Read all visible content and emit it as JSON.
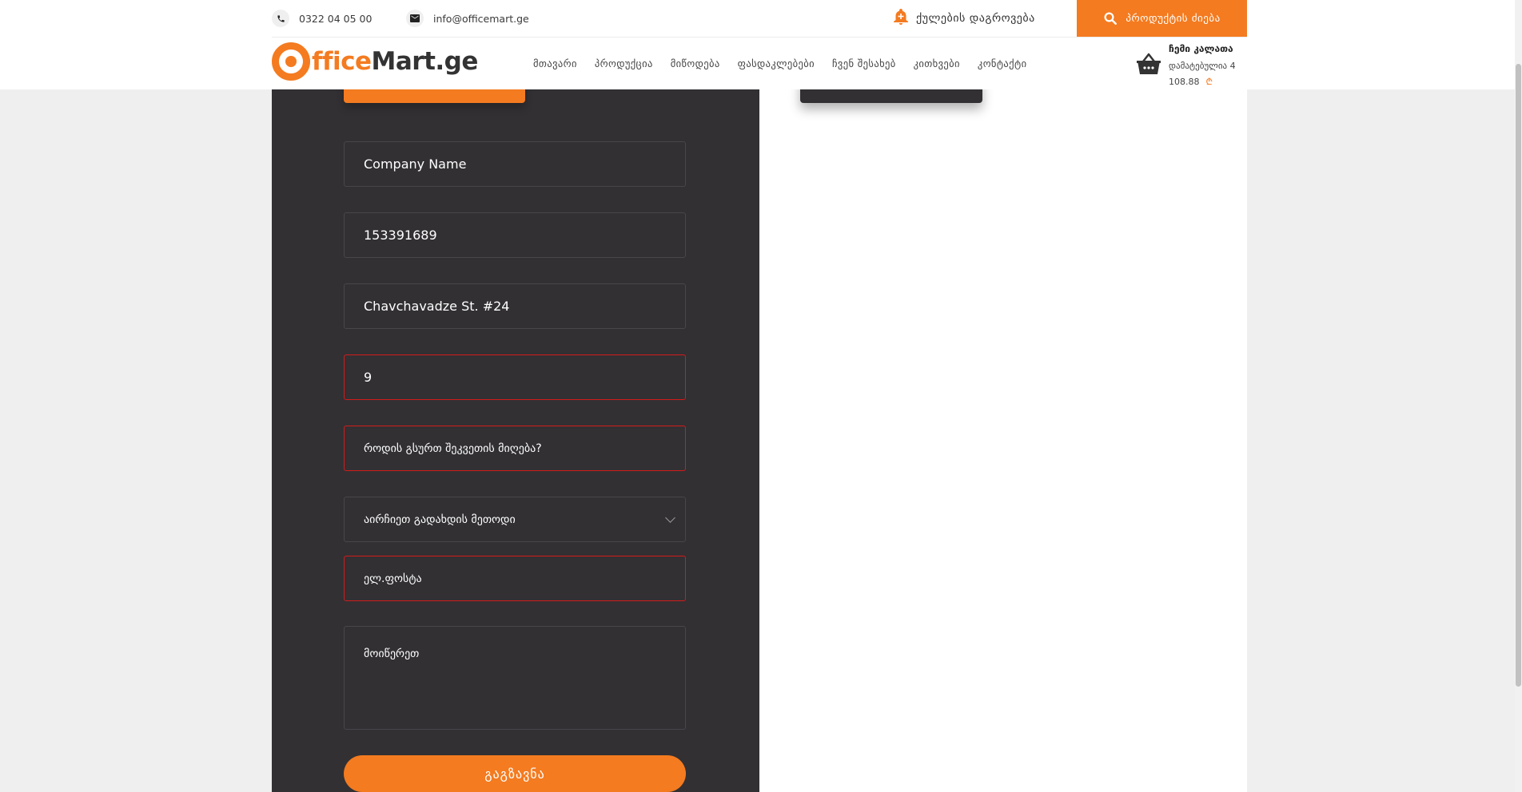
{
  "header": {
    "phone": "0322 04 05 00",
    "email": "info@officemart.ge",
    "order_tracking": "ქულების დაგროვება",
    "search_button": "პროდუქტის ძიება",
    "logo": {
      "part1": "ffice",
      "part2": "Mart.ge"
    },
    "nav": [
      {
        "label": "მთავარი"
      },
      {
        "label": "პროდუქცია"
      },
      {
        "label": "მიწოდება"
      },
      {
        "label": "ფასდაკლებები"
      },
      {
        "label": "ჩვენ შესახებ"
      },
      {
        "label": "კითხვები"
      },
      {
        "label": "კონტაქტი"
      }
    ],
    "cart": {
      "title": "ჩემი კალათა",
      "added": "დამატებულია 4",
      "total": "108.88",
      "currency_symbol": "₾"
    }
  },
  "form": {
    "company_name": "Company Name",
    "company_id": "153391689",
    "address": "Chavchavadze St. #24",
    "phone_value": "9",
    "delivery_time_placeholder": "როდის გსურთ შეკვეთის მიღება?",
    "payment_method": "აირჩიეთ გადახდის მეთოდი",
    "email_placeholder": "ელ.ფოსტა",
    "comment_placeholder": "მოიწერეთ",
    "submit": "გაგზავნა"
  },
  "colors": {
    "accent": "#f47b20",
    "panel_dark": "#323033",
    "error_border": "#d41a1a"
  }
}
